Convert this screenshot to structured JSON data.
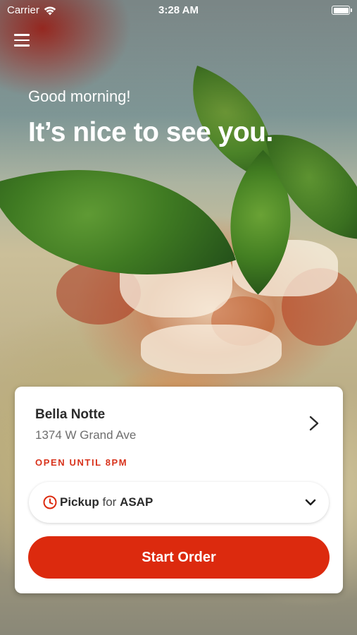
{
  "status_bar": {
    "carrier": "Carrier",
    "time": "3:28 AM",
    "wifi_icon": "wifi-icon",
    "battery_icon": "battery-icon"
  },
  "header": {
    "menu_icon": "hamburger-menu-icon",
    "greeting": "Good morning!",
    "headline": "It’s nice to see you."
  },
  "store_card": {
    "name": "Bella Notte",
    "address": "1374 W Grand Ave",
    "hours": "OPEN UNTIL 8PM",
    "chevron_icon": "chevron-right-icon"
  },
  "order_type": {
    "icon": "clock-icon",
    "mode": "Pickup",
    "connector": "for",
    "time": "ASAP",
    "dropdown_icon": "chevron-down-icon"
  },
  "cta": {
    "label": "Start Order"
  },
  "colors": {
    "accent": "#dc2a0e",
    "hours_text": "#d8331c",
    "card_background": "#ffffff"
  }
}
